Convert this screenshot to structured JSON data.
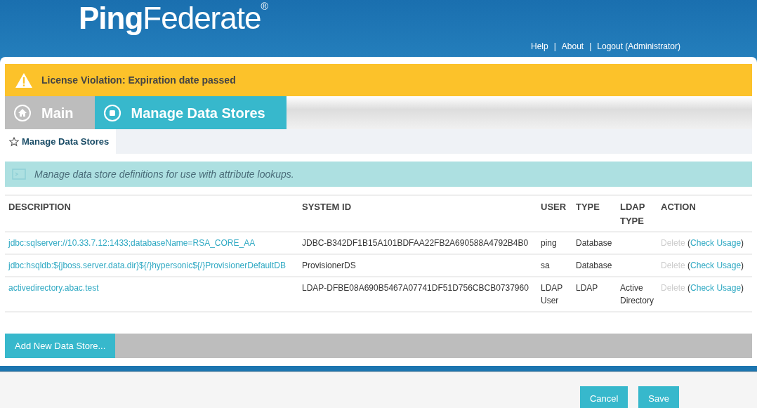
{
  "header": {
    "logo": "**Ping**Federate$^{®}$",
    "links": [
      "Help",
      "About",
      "Logout (Administrator)"
    ],
    "separator": "|"
  },
  "alert": {
    "text": "License Violation: Expiration date passed"
  },
  "tabs": [
    {
      "label": "Main",
      "kind": "home",
      "selected": false
    },
    {
      "label": "Manage Data Stores",
      "kind": "page",
      "selected": true
    }
  ],
  "subtabs": [
    {
      "label": "Manage Data Stores",
      "selected": true
    }
  ],
  "info": "Manage data store definitions for use with attribute lookups.",
  "table": {
    "columns": [
      "DESCRIPTION",
      "SYSTEM ID",
      "USER",
      "TYPE",
      "LDAP TYPE",
      "ACTION"
    ],
    "rows": [
      {
        "description": "jdbc:sqlserver://10.33.7.12:1433;databaseName=RSA_CORE_AA",
        "system_id": "JDBC-B342DF1B15A101BDFAA22FB2A690588A4792B4B0",
        "user": "ping",
        "type": "Database",
        "ldap_type": "",
        "delete": {
          "label": "Delete",
          "disabled": true
        },
        "usage": {
          "open": "(",
          "label": "Check Usage",
          "close": ")"
        }
      },
      {
        "description": "jdbc:hsqldb:${jboss.server.data.dir}${/}hypersonic${/}ProvisionerDefaultDB",
        "system_id": "ProvisionerDS",
        "user": "sa",
        "type": "Database",
        "ldap_type": "",
        "delete": {
          "label": "Delete",
          "disabled": true
        },
        "usage": {
          "open": "(",
          "label": "Check Usage",
          "close": ")"
        }
      },
      {
        "description": "activedirectory.abac.test",
        "system_id": "LDAP-DFBE08A690B5467A07741DF51D756CBCB0737960",
        "user": "LDAP User",
        "type": "LDAP",
        "ldap_type": "Active Directory",
        "delete": {
          "label": "Delete",
          "disabled": true
        },
        "usage": {
          "open": "(",
          "label": "Check Usage",
          "close": ")"
        }
      }
    ]
  },
  "add_button": "Add New Data Store...",
  "footer_buttons": [
    "Cancel",
    "Save"
  ]
}
